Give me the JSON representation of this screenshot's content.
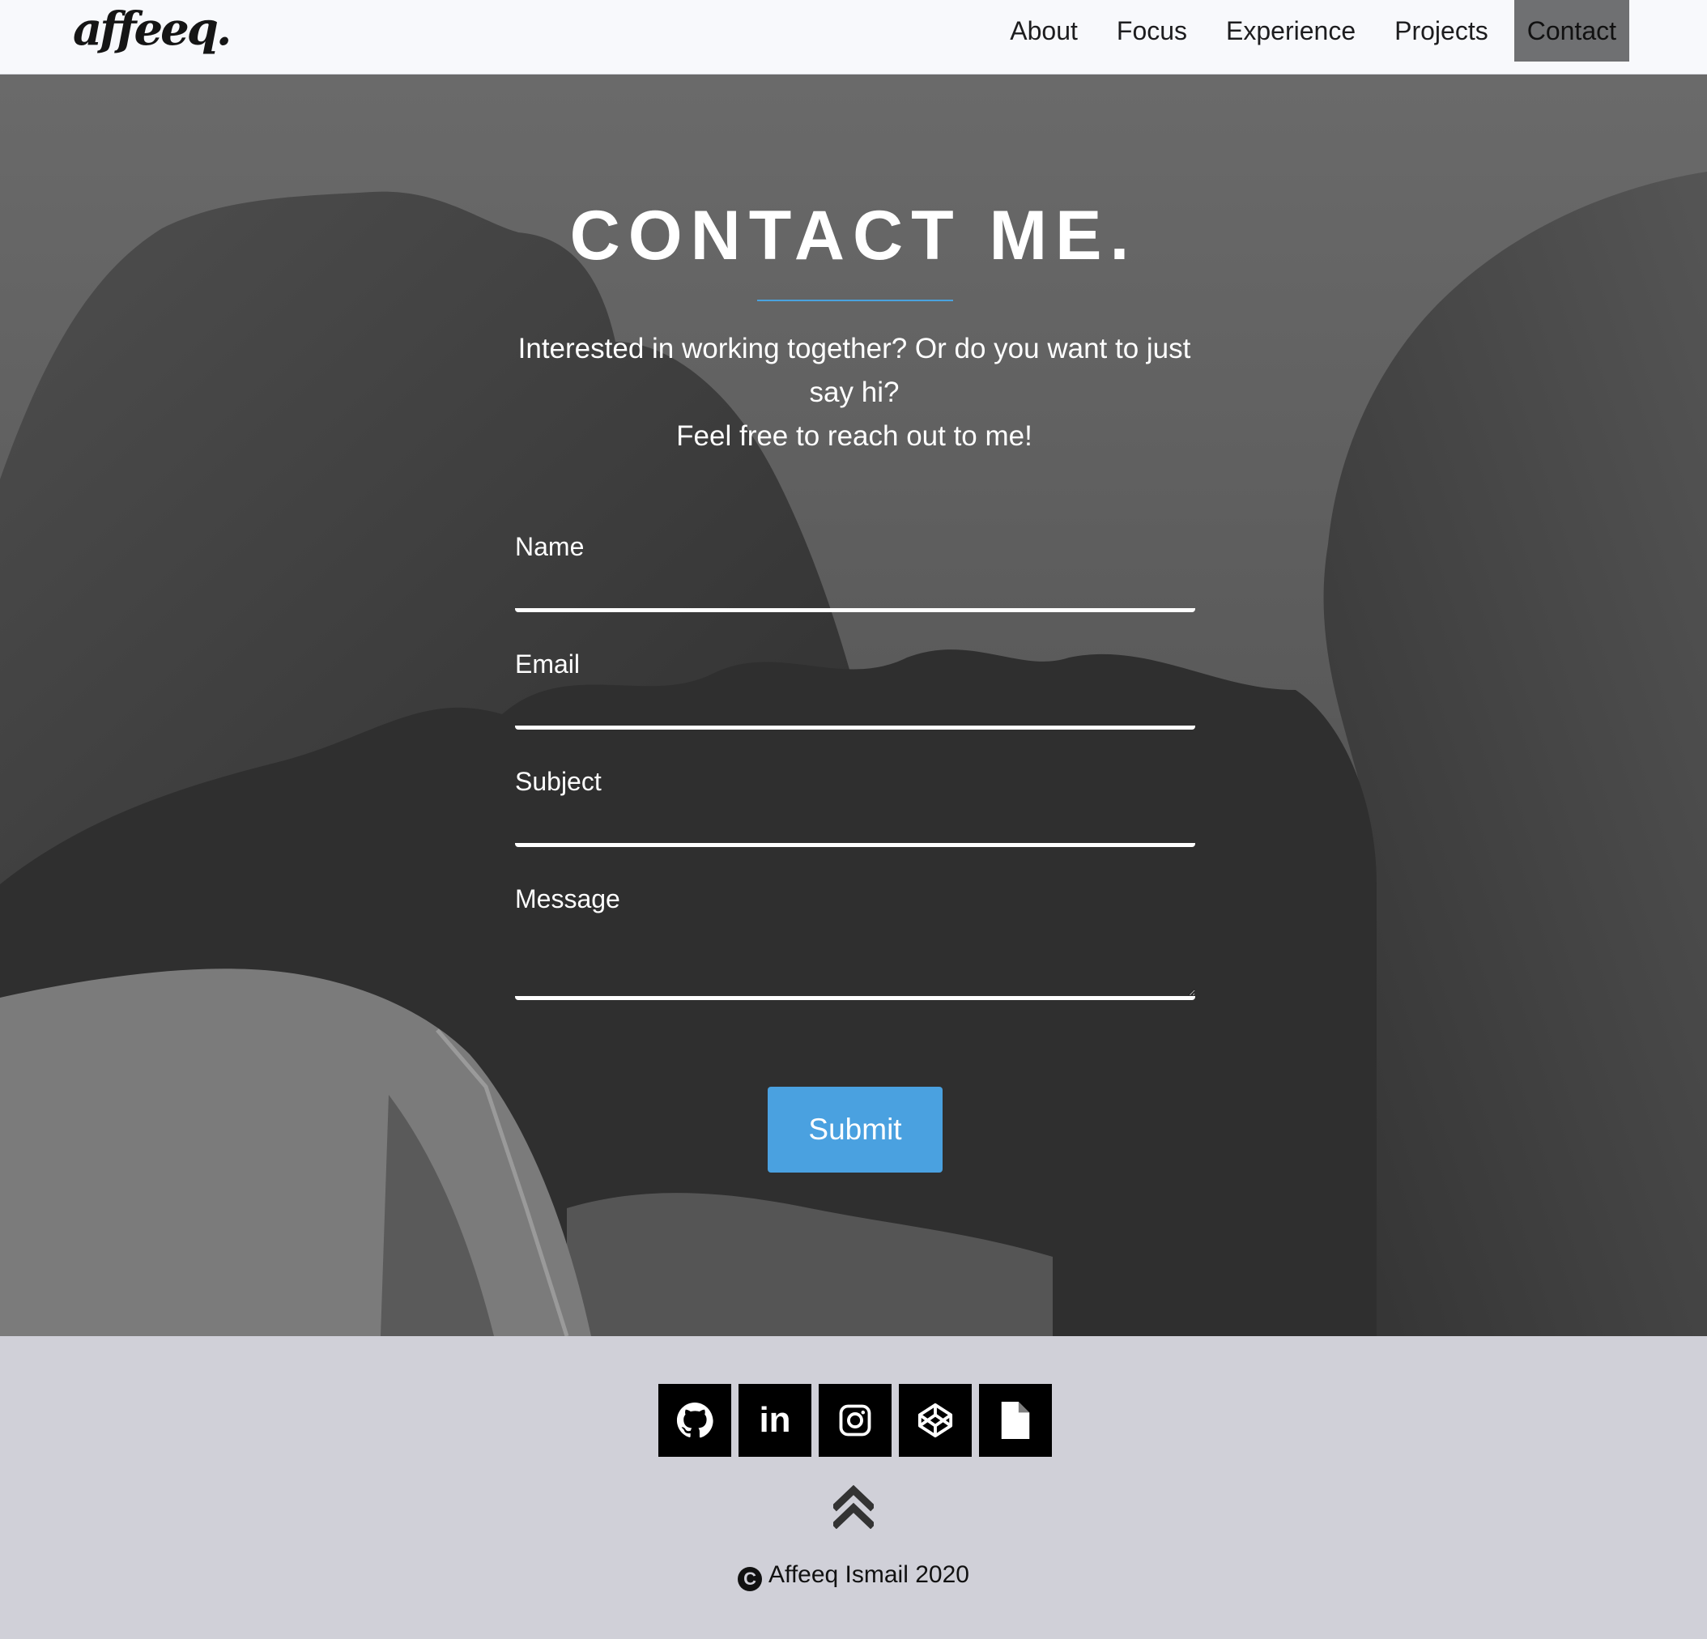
{
  "nav": {
    "logo": "affeeq.",
    "links": [
      "About",
      "Focus",
      "Experience",
      "Projects",
      "Contact"
    ],
    "active": "Contact"
  },
  "hero": {
    "title": "CONTACT ME.",
    "intro_line1": "Interested in working together? Or do you want to just say hi?",
    "intro_line2": "Feel free to reach out to me!",
    "accent_color": "#4aa3df"
  },
  "form": {
    "name_label": "Name",
    "email_label": "Email",
    "subject_label": "Subject",
    "message_label": "Message",
    "submit_label": "Submit",
    "submit_color": "#4aa1e0"
  },
  "footer": {
    "socials": [
      "github-icon",
      "linkedin-icon",
      "instagram-icon",
      "codepen-icon",
      "resume-file-icon"
    ],
    "linkedin_text": "in",
    "back_to_top_icon": "double-chevron-up-icon",
    "copyright_symbol": "C",
    "copyright": "Affeeq Ismail 2020"
  }
}
